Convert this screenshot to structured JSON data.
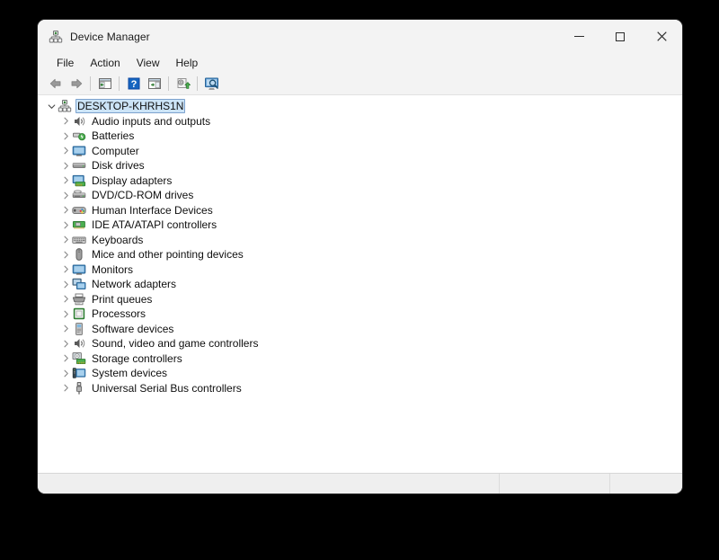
{
  "window": {
    "title": "Device Manager",
    "title_icon": "device-manager-icon",
    "caption": {
      "minimize_label": "Minimize",
      "maximize_label": "Maximize",
      "close_label": "Close"
    }
  },
  "menubar": {
    "items": [
      {
        "label": "File",
        "name": "menu-file"
      },
      {
        "label": "Action",
        "name": "menu-action"
      },
      {
        "label": "View",
        "name": "menu-view"
      },
      {
        "label": "Help",
        "name": "menu-help"
      }
    ]
  },
  "toolbar": {
    "buttons": [
      {
        "name": "back-button",
        "icon": "back-arrow-icon",
        "label": "Back"
      },
      {
        "name": "forward-button",
        "icon": "forward-arrow-icon",
        "label": "Forward"
      },
      {
        "name": "show-hide-console-tree-button",
        "icon": "console-tree-icon",
        "label": "Show/Hide Console Tree"
      },
      {
        "name": "help-button",
        "icon": "help-question-icon",
        "label": "Help"
      },
      {
        "name": "properties-button",
        "icon": "properties-window-icon",
        "label": "Properties"
      },
      {
        "name": "update-driver-button",
        "icon": "update-driver-icon",
        "label": "Update Driver Software"
      },
      {
        "name": "scan-hardware-changes-button",
        "icon": "scan-monitor-icon",
        "label": "Scan for hardware changes"
      }
    ]
  },
  "tree": {
    "root": {
      "label": "DESKTOP-KHRHS1N",
      "icon": "computer-node-icon",
      "expanded": true,
      "selected": true
    },
    "items": [
      {
        "label": "Audio inputs and outputs",
        "icon": "speaker-icon",
        "expanded": false
      },
      {
        "label": "Batteries",
        "icon": "battery-icon",
        "expanded": false
      },
      {
        "label": "Computer",
        "icon": "monitor-icon",
        "expanded": false
      },
      {
        "label": "Disk drives",
        "icon": "disk-drive-icon",
        "expanded": false
      },
      {
        "label": "Display adapters",
        "icon": "display-adapter-icon",
        "expanded": false
      },
      {
        "label": "DVD/CD-ROM drives",
        "icon": "optical-drive-icon",
        "expanded": false
      },
      {
        "label": "Human Interface Devices",
        "icon": "hid-icon",
        "expanded": false
      },
      {
        "label": "IDE ATA/ATAPI controllers",
        "icon": "ide-controller-icon",
        "expanded": false
      },
      {
        "label": "Keyboards",
        "icon": "keyboard-icon",
        "expanded": false
      },
      {
        "label": "Mice and other pointing devices",
        "icon": "mouse-icon",
        "expanded": false
      },
      {
        "label": "Monitors",
        "icon": "monitor-icon",
        "expanded": false
      },
      {
        "label": "Network adapters",
        "icon": "network-adapter-icon",
        "expanded": false
      },
      {
        "label": "Print queues",
        "icon": "printer-icon",
        "expanded": false
      },
      {
        "label": "Processors",
        "icon": "processor-icon",
        "expanded": false
      },
      {
        "label": "Software devices",
        "icon": "software-device-icon",
        "expanded": false
      },
      {
        "label": "Sound, video and game controllers",
        "icon": "speaker-icon",
        "expanded": false
      },
      {
        "label": "Storage controllers",
        "icon": "storage-controller-icon",
        "expanded": false
      },
      {
        "label": "System devices",
        "icon": "system-device-icon",
        "expanded": false
      },
      {
        "label": "Universal Serial Bus controllers",
        "icon": "usb-icon",
        "expanded": false
      }
    ]
  },
  "statusbar": {
    "panes": [
      "",
      "",
      ""
    ]
  },
  "colors": {
    "selection_fill": "#cce4f7",
    "selection_border": "#7da2ce",
    "chrome": "#f3f3f3",
    "status_bg": "#efefef",
    "accent_blue": "#1f7fd4"
  }
}
